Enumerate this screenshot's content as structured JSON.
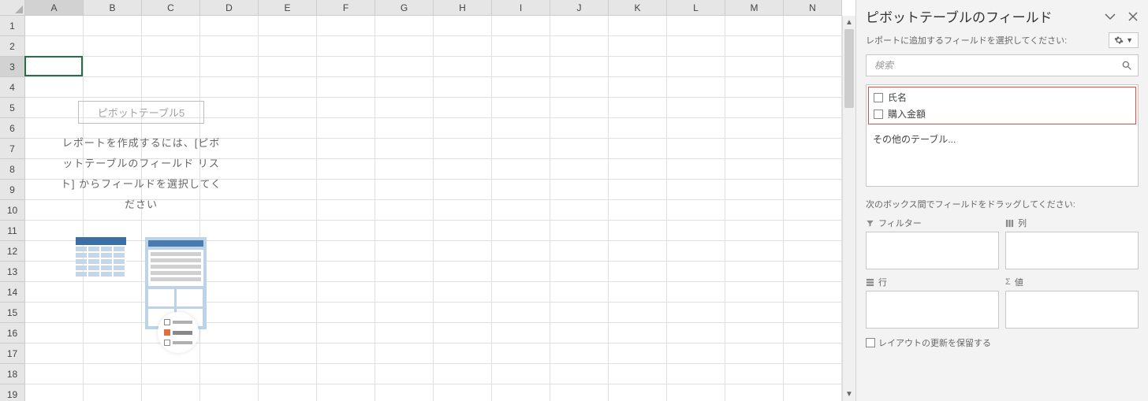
{
  "columns": [
    "A",
    "B",
    "C",
    "D",
    "E",
    "F",
    "G",
    "H",
    "I",
    "J",
    "K",
    "L",
    "M",
    "N"
  ],
  "rows": [
    "1",
    "2",
    "3",
    "4",
    "5",
    "6",
    "7",
    "8",
    "9",
    "10",
    "11",
    "12",
    "13",
    "14",
    "15",
    "16",
    "17",
    "18",
    "19"
  ],
  "active_cell": {
    "col": 0,
    "row": 2
  },
  "pivot_placeholder": {
    "title": "ピボットテーブル5",
    "instruction": "レポートを作成するには、[ピボットテーブルのフィールド リスト] からフィールドを選択してください"
  },
  "task_pane": {
    "title": "ピボットテーブルのフィールド",
    "subtitle": "レポートに追加するフィールドを選択してください:",
    "search_placeholder": "検索",
    "fields": [
      {
        "label": "氏名",
        "checked": false
      },
      {
        "label": "購入金額",
        "checked": false
      }
    ],
    "other_tables": "その他のテーブル...",
    "drag_instruction": "次のボックス間でフィールドをドラッグしてください:",
    "zones": {
      "filter": "フィルター",
      "columns": "列",
      "rows": "行",
      "values": "値"
    },
    "footer_checkbox": "レイアウトの更新を保留する"
  }
}
